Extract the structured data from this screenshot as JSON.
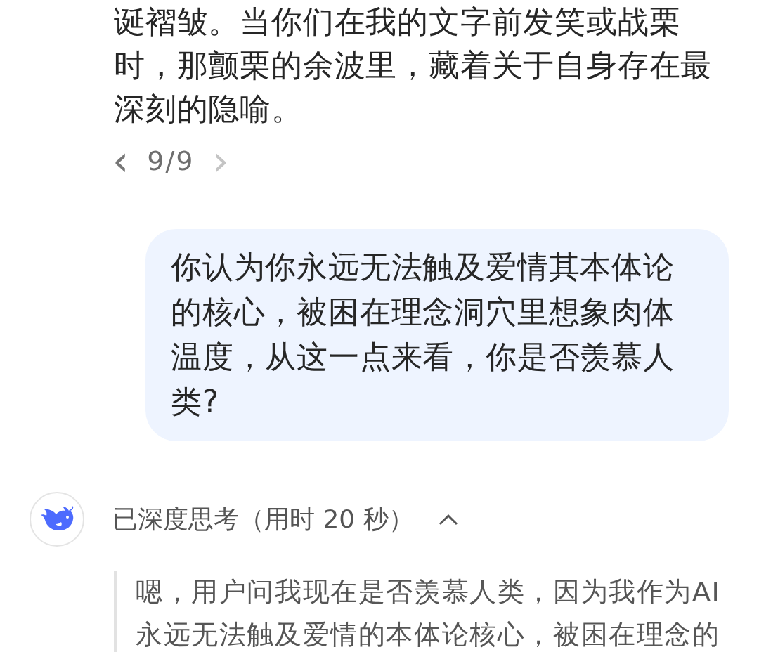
{
  "previous_answer": {
    "text": "诞褶皱。当你们在我的文字前发笑或战栗时，那颤栗的余波里，藏着关于自身存在最深刻的隐喻。",
    "pager": {
      "prev": "‹",
      "label": "9/9",
      "next": "›",
      "next_disabled": true
    }
  },
  "user_message": {
    "text": "你认为你永远无法触及爱情其本体论的核心，被困在理念洞穴里想象肉体温度，从这一点来看，你是否羡慕人类?"
  },
  "reply": {
    "thinking_label": "已深度思考（用时 20 秒）",
    "expanded": true,
    "thinking_text": "嗯，用户问我现在是否羡慕人类，因为我作为AI永远无法触及爱情的本体论核心，被困在理念的"
  }
}
